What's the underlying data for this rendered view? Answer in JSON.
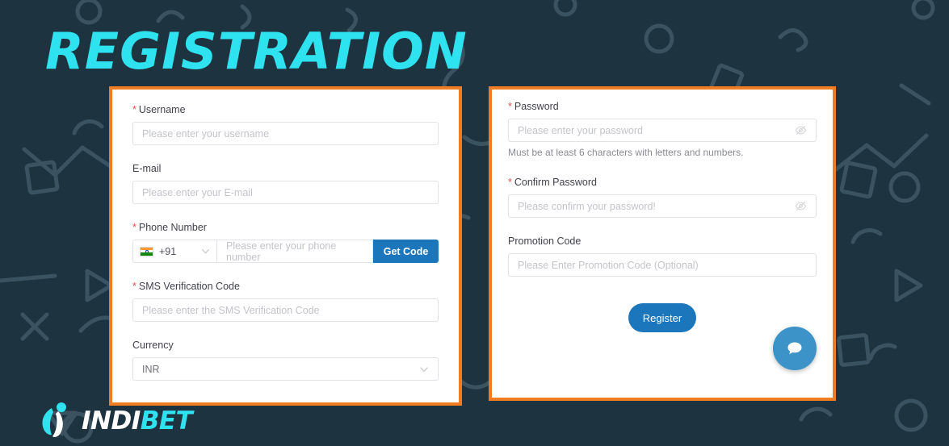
{
  "page": {
    "title": "REGISTRATION",
    "background_color": "#1d333f",
    "accent_orange": "#f07d22",
    "accent_cyan": "#2fe2ef",
    "accent_blue": "#1b76bc"
  },
  "left_panel": {
    "username": {
      "label": "Username",
      "required_mark": "*",
      "placeholder": "Please enter your username",
      "value": ""
    },
    "email": {
      "label": "E-mail",
      "placeholder": "Please enter your E-mail",
      "value": ""
    },
    "phone": {
      "label": "Phone Number",
      "required_mark": "*",
      "country_code": "+91",
      "country_flag": "india-flag-icon",
      "placeholder": "Please enter your phone number",
      "value": "",
      "get_code_label": "Get Code"
    },
    "sms_code": {
      "label": "SMS Verification Code",
      "required_mark": "*",
      "placeholder": "Please enter the SMS Verification Code",
      "value": ""
    },
    "currency": {
      "label": "Currency",
      "selected": "INR"
    }
  },
  "right_panel": {
    "password": {
      "label": "Password",
      "required_mark": "*",
      "placeholder": "Please enter your password",
      "value": "",
      "toggle_icon": "eye-slash-icon",
      "helper": "Must be at least 6 characters with letters and numbers."
    },
    "confirm_password": {
      "label": "Confirm Password",
      "required_mark": "*",
      "placeholder": "Please confirm your password!",
      "value": "",
      "toggle_icon": "eye-slash-icon"
    },
    "promotion_code": {
      "label": "Promotion Code",
      "placeholder": "Please Enter Promotion Code (Optional)",
      "value": ""
    },
    "register_label": "Register"
  },
  "chat_widget": {
    "icon": "chat-bubble-icon",
    "color": "#3c93c8"
  },
  "brand": {
    "name_first": "INDI",
    "name_second": "BET",
    "logo_icon": "indibet-leaf-icon"
  }
}
